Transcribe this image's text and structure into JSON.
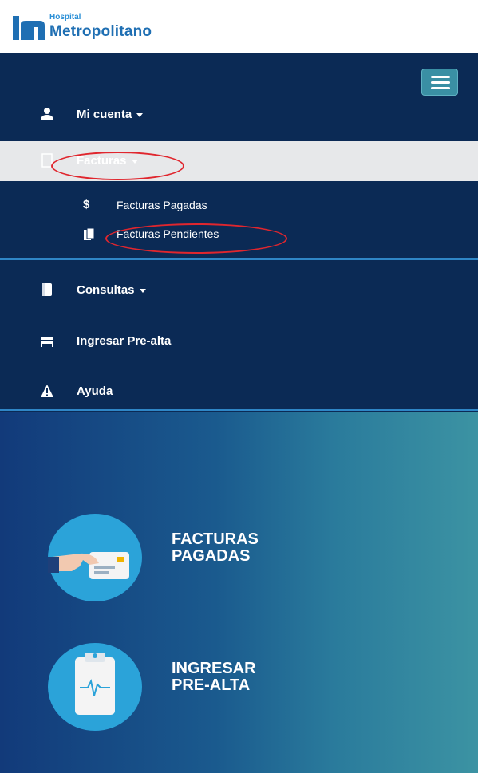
{
  "brand": {
    "small": "Hospital",
    "big": "Metropolitano",
    "color": "#1f6fb3"
  },
  "nav": {
    "toggle_icon": "hamburger-icon",
    "items": [
      {
        "label": "Mi cuenta",
        "icon": "user-icon",
        "has_caret": true
      },
      {
        "label": "Facturas",
        "icon": "file-icon",
        "has_caret": true,
        "state": "expanded"
      },
      {
        "label": "Consultas",
        "icon": "book-icon",
        "has_caret": true
      },
      {
        "label": "Ingresar Pre-alta",
        "icon": "bed-icon",
        "has_caret": false
      },
      {
        "label": "Ayuda",
        "icon": "warning-icon",
        "has_caret": false
      }
    ],
    "submenu": [
      {
        "label": "Facturas Pagadas",
        "icon": "dollar-icon",
        "glyph": "$"
      },
      {
        "label": "Facturas Pendientes",
        "icon": "documents-icon"
      }
    ],
    "colors": {
      "background": "#0b2a55",
      "active_row": "#e7e8ea",
      "highlight": "#e0262e"
    }
  },
  "dashboard": {
    "cards": [
      {
        "label": "FACTURAS\nPAGADAS",
        "icon": "card-payment-icon"
      },
      {
        "label": "INGRESAR\nPRE-ALTA",
        "icon": "clipboard-heartbeat-icon"
      }
    ]
  }
}
